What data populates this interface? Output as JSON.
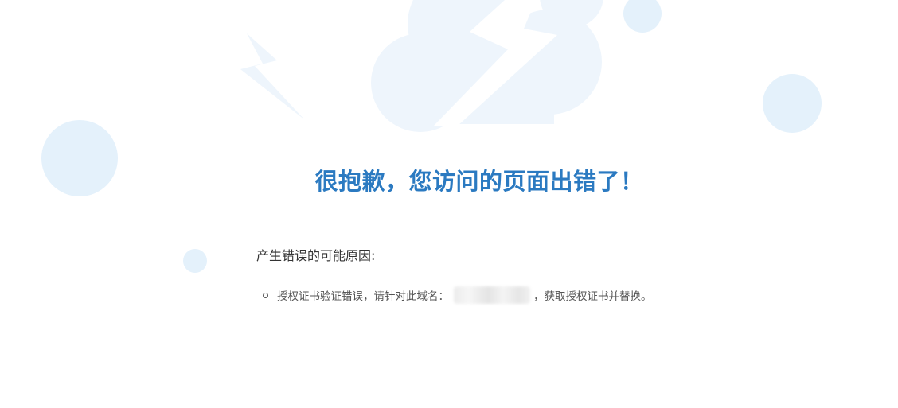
{
  "error": {
    "title": "很抱歉，您访问的页面出错了！",
    "reasons_heading": "产生错误的可能原因:",
    "reasons": [
      {
        "prefix": "授权证书验证错误，请针对此域名：",
        "suffix": "，获取授权证书并替换。"
      }
    ]
  },
  "illustration": {
    "icon": "cloud-lightning-icon",
    "colors": {
      "cloud": "#eef5fc",
      "circle": "#e3f0fa",
      "title": "#2b7ac1"
    }
  }
}
